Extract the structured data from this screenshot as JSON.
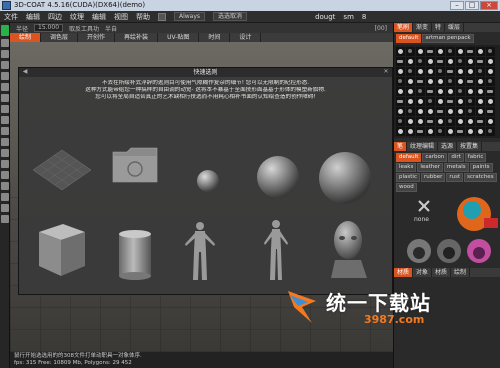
{
  "window": {
    "title": "3D-COAT 4.5.16(CUDA)(DX64)(demo)"
  },
  "menu": {
    "items": [
      "文件",
      "编辑",
      "四边",
      "纹理",
      "编辑",
      "视图",
      "帮助"
    ],
    "mode_value": "Always",
    "sel_value": "选选取消",
    "right_labels": [
      "dougt",
      "sm",
      "8"
    ]
  },
  "toolbar2": {
    "field1": "半径",
    "field1_value": "15.000",
    "label2": "取反工具功",
    "label3": "半自",
    "label4": "[00]"
  },
  "tabs": [
    "绘制",
    "调色层",
    "开创作",
    "再绘补装",
    "UV-贴图",
    "时间",
    "设计",
    "[00]"
  ],
  "dialog": {
    "title": "快速选则",
    "description": [
      "不去在所绘补式浮辞的逃则目可使用气隙糊作复杂的细节! 您可以无限制的纪控形态.",
      "这种方式能带给您一种搞样的自由调的动觉- 这将本不暴基于至面技形面基基于形体的模塑新旗物.",
      "您可以将全局自适合真正的艺术缺相行技选而不用耗心相补书面的认知绘查造的创作障碍!"
    ]
  },
  "rightpanel": {
    "tabs": [
      "笔刷",
      "渐变",
      "特",
      "缓层"
    ],
    "strip_label": "artman penpack",
    "grid_tabs": [
      "笔",
      "纹理编辑",
      "选源",
      "按置集"
    ],
    "default_chip": "default",
    "chips": [
      "default",
      "carbon",
      "dirt",
      "fabric",
      "leaks",
      "leather",
      "metals",
      "paints",
      "plastic",
      "rubber",
      "rust",
      "scratches",
      "wood"
    ],
    "none_label": "none",
    "bottom_tabs": [
      "材质",
      "对象",
      "材质",
      "绘制"
    ]
  },
  "status": {
    "line1": "鼠行开始选选用的的308文件打单动职具一对象体序.",
    "line2": "fps: 315  Free: 10809 Mb, Polygons: 29 452"
  },
  "watermark": {
    "name": "统一下载站",
    "url": "3987.com"
  },
  "colors": {
    "accent": "#d9541f",
    "green": "#27b34a"
  }
}
